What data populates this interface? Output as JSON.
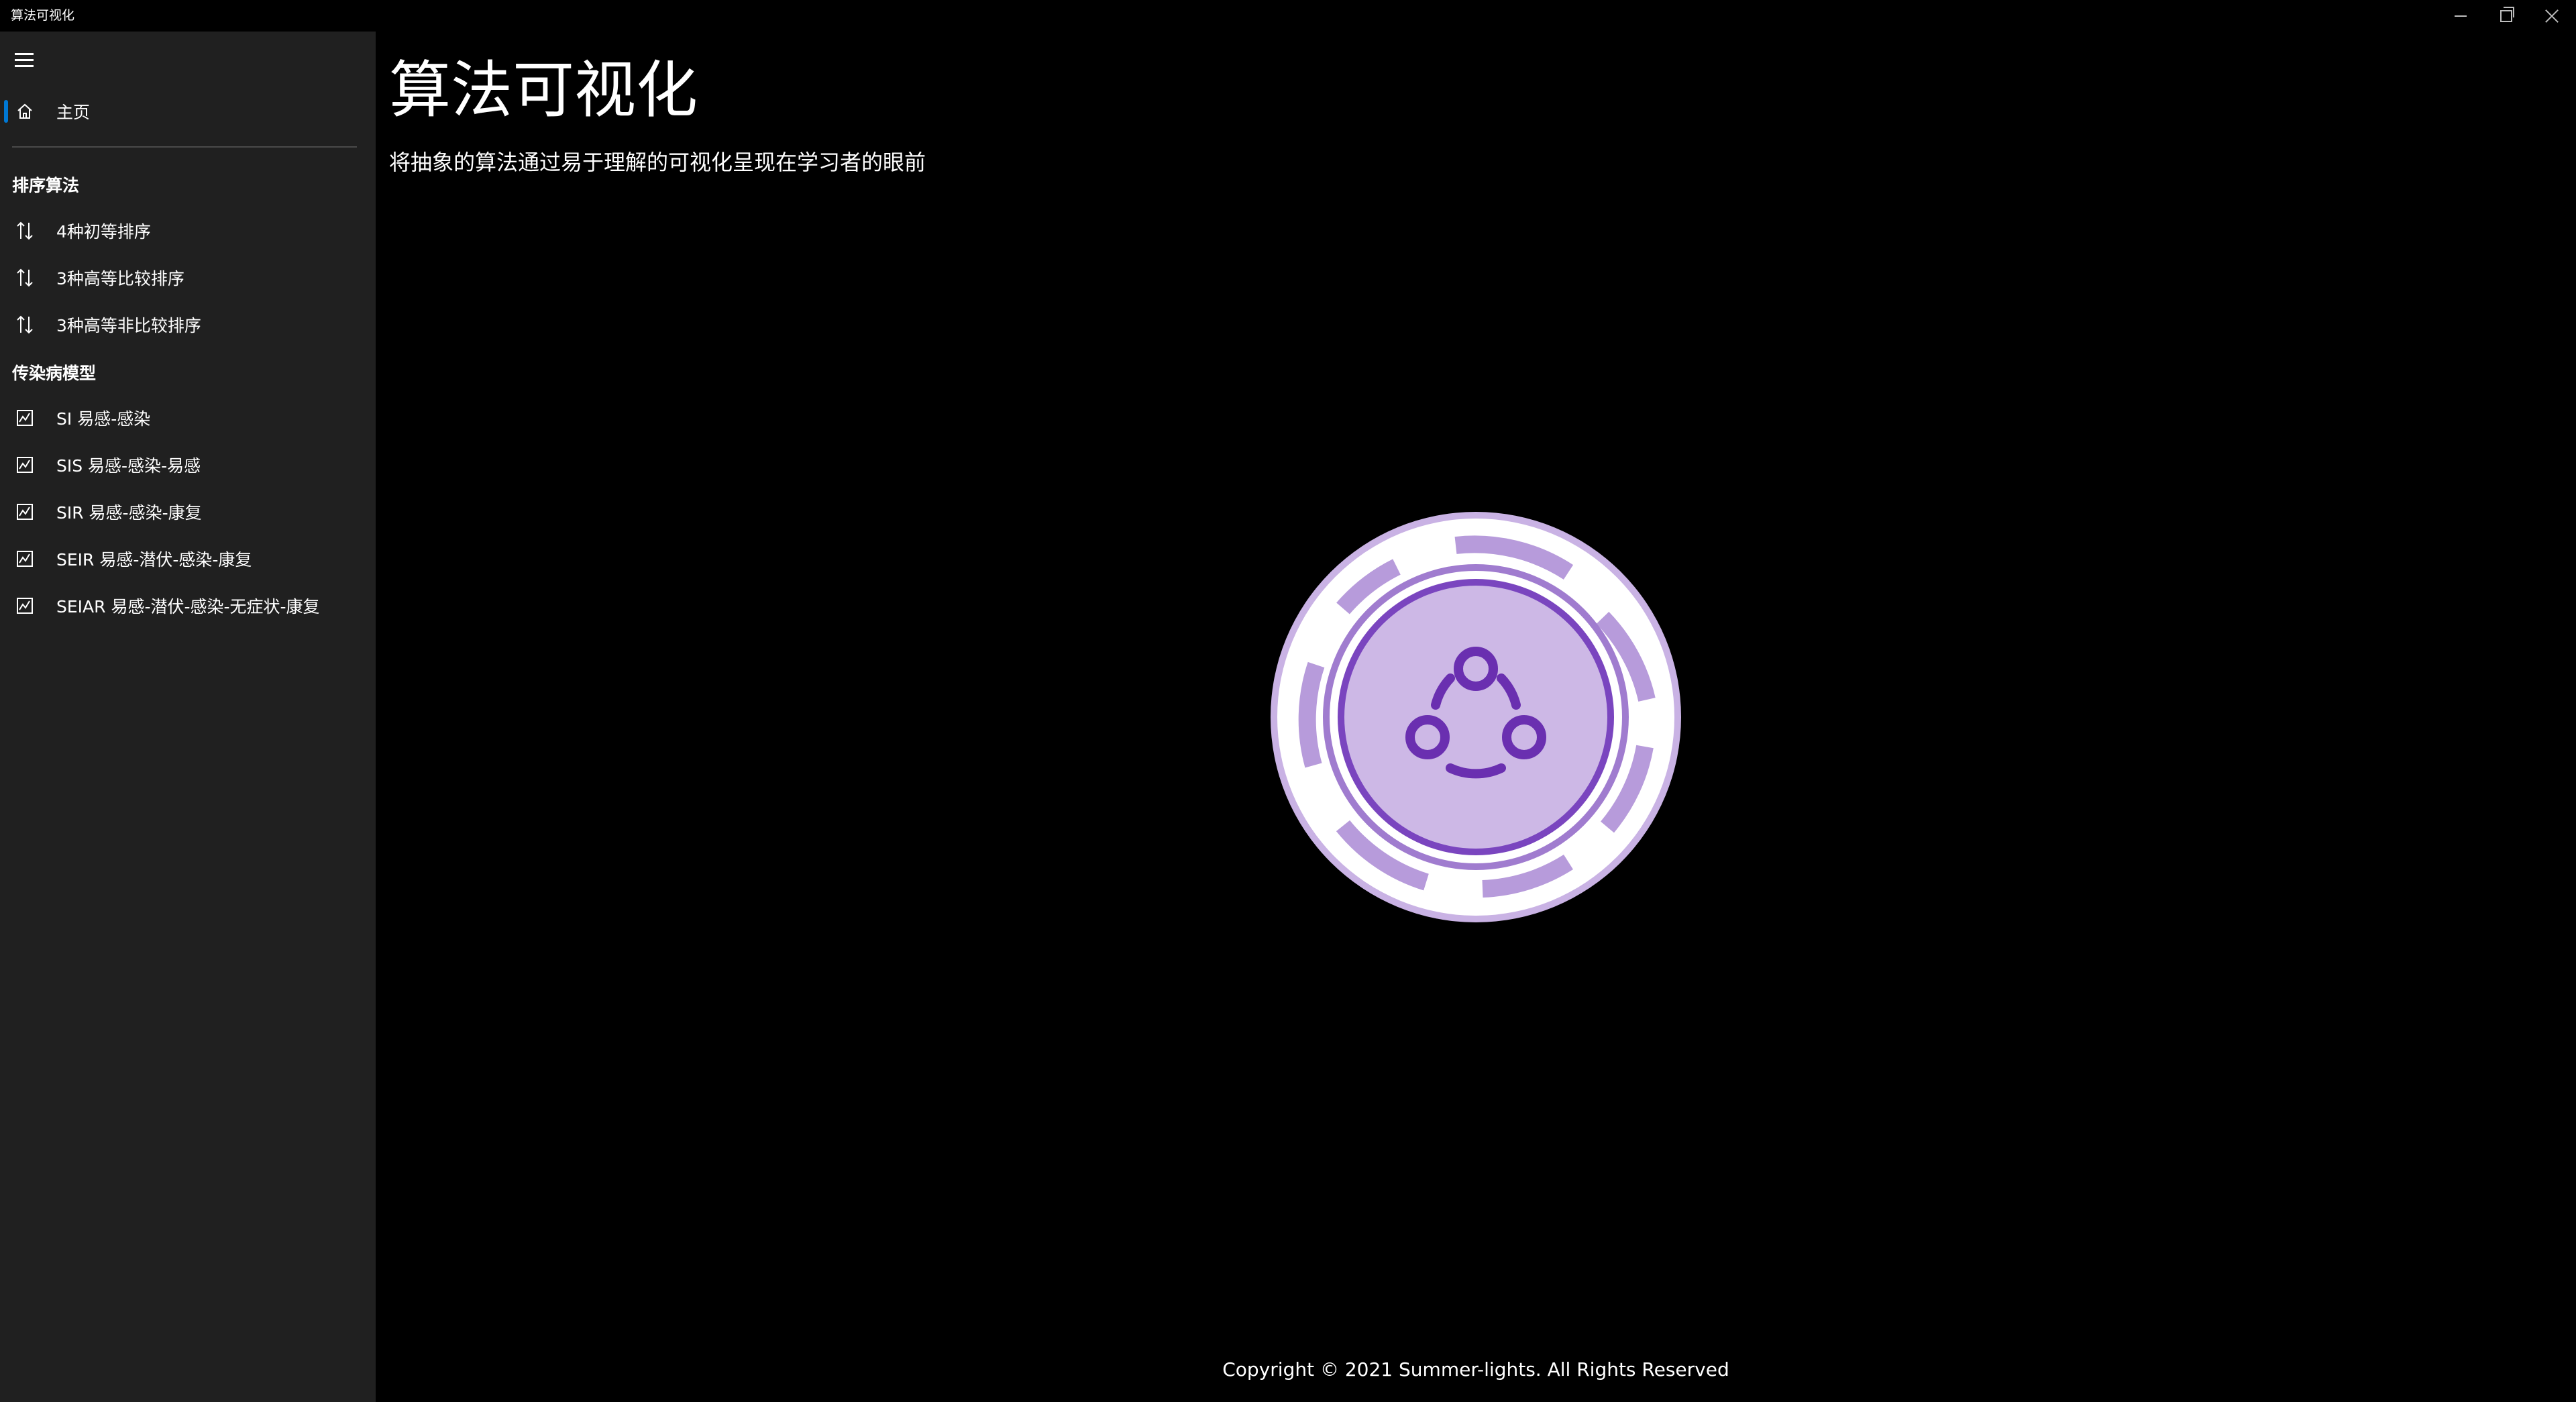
{
  "window": {
    "title": "算法可视化"
  },
  "sidebar": {
    "home_label": "主页",
    "sort_group_header": "排序算法",
    "sort_items": [
      {
        "label": "4种初等排序",
        "icon": "sort-arrows-icon"
      },
      {
        "label": "3种高等比较排序",
        "icon": "sort-arrows-icon"
      },
      {
        "label": "3种高等非比较排序",
        "icon": "sort-arrows-icon"
      }
    ],
    "model_group_header": "传染病模型",
    "model_items": [
      {
        "label": "SI 易感-感染",
        "icon": "chart-icon"
      },
      {
        "label": "SIS 易感-感染-易感",
        "icon": "chart-icon"
      },
      {
        "label": "SIR 易感-感染-康复",
        "icon": "chart-icon"
      },
      {
        "label": "SEIR 易感-潜伏-感染-康复",
        "icon": "chart-icon"
      },
      {
        "label": "SEIAR 易感-潜伏-感染-无症状-康复",
        "icon": "chart-icon"
      }
    ]
  },
  "main": {
    "title": "算法可视化",
    "subtitle": "将抽象的算法通过易于理解的可视化呈现在学习者的眼前",
    "footer": "Copyright © 2021 Summer-lights. All Rights Reserved"
  },
  "colors": {
    "accent": "#0078d4",
    "sidebar_bg": "#202020",
    "logo_purple": "#6a2fb0",
    "logo_light": "#cdb8e6"
  }
}
